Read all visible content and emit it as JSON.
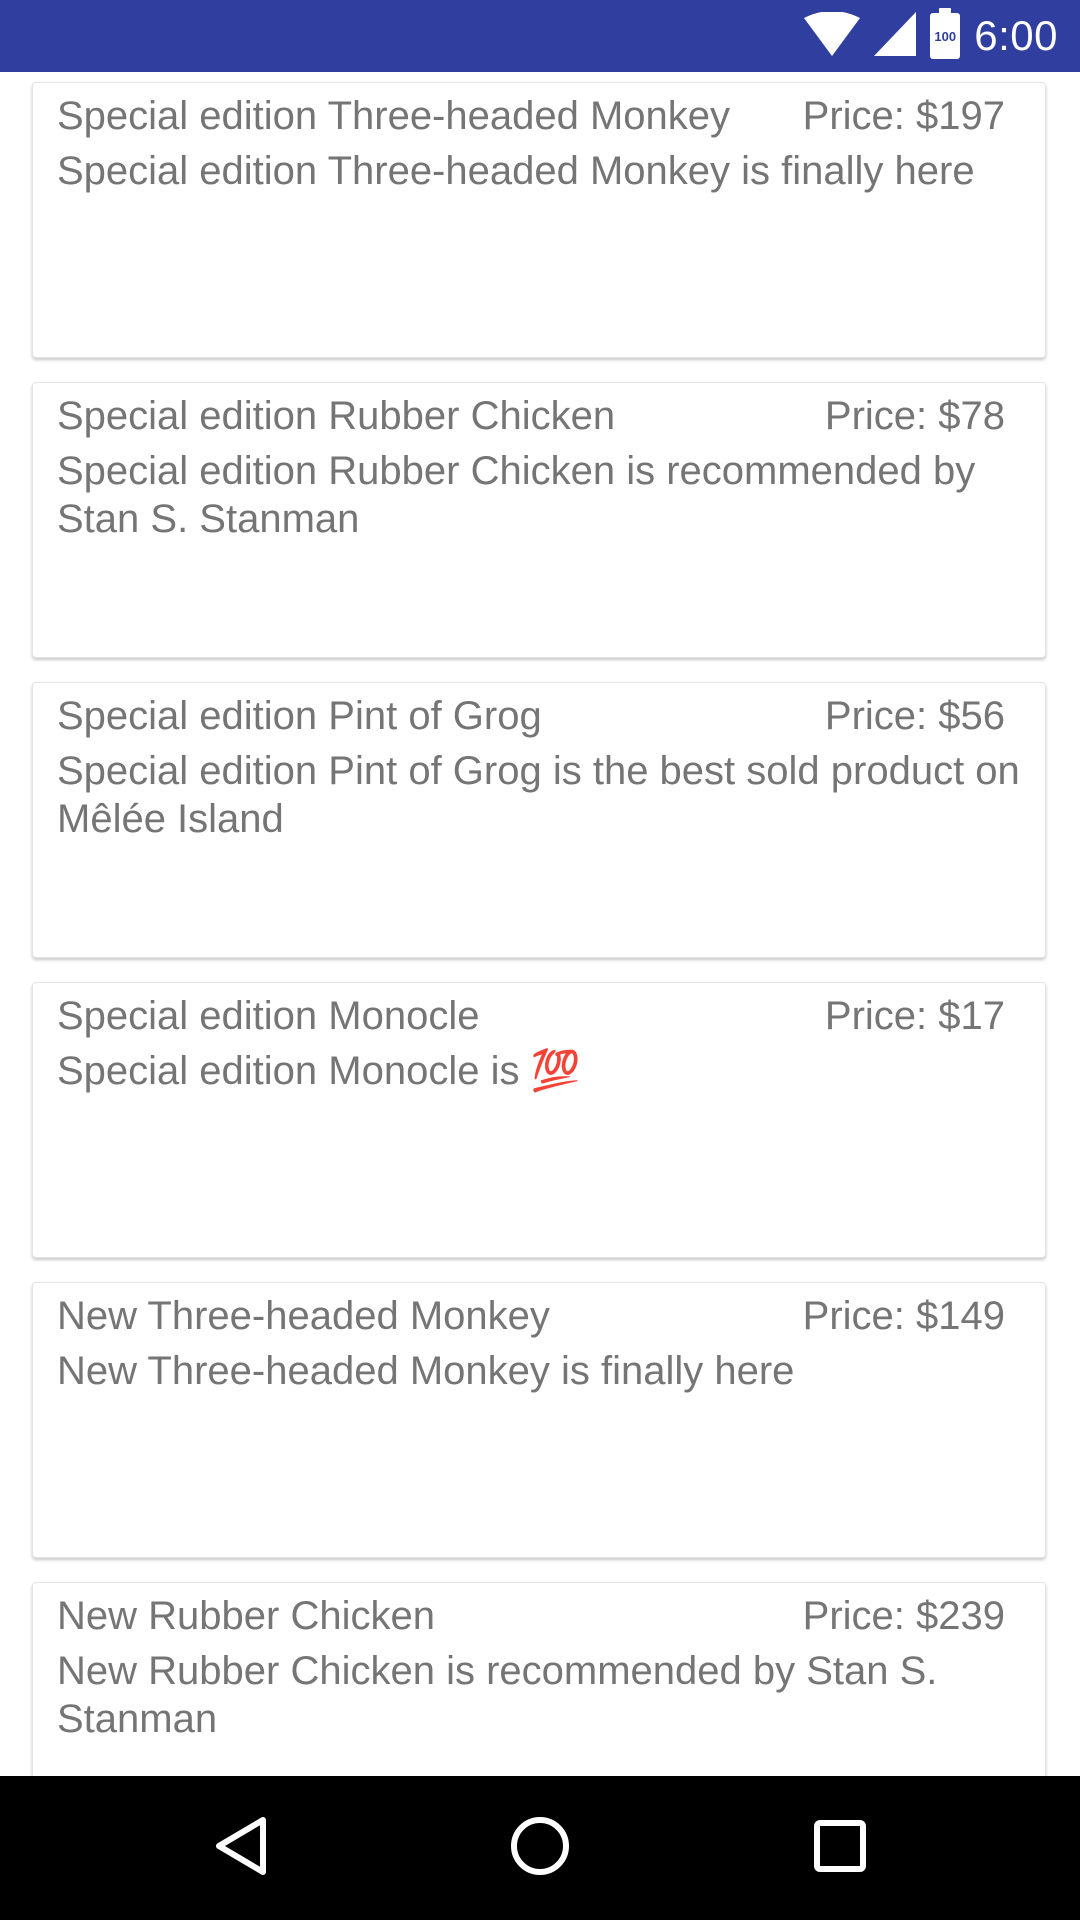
{
  "status_bar": {
    "time": "6:00",
    "battery_level": "100",
    "bar_color": "#303f9f",
    "icons": [
      "wifi-icon",
      "cellular-signal-icon",
      "battery-icon"
    ]
  },
  "products": [
    {
      "title": "Special edition Three-headed Monkey",
      "price": "Price: $197",
      "description": "Special edition Three-headed Monkey is finally here"
    },
    {
      "title": "Special edition Rubber Chicken",
      "price": "Price: $78",
      "description": "Special edition Rubber Chicken is recommended by Stan S. Stanman"
    },
    {
      "title": "Special edition Pint of Grog",
      "price": "Price: $56",
      "description": "Special edition Pint of Grog is the best sold product on Mêlée Island"
    },
    {
      "title": "Special edition Monocle",
      "price": "Price: $17",
      "description": "Special edition Monocle is 💯"
    },
    {
      "title": "New Three-headed Monkey",
      "price": "Price: $149",
      "description": "New Three-headed Monkey is finally here"
    },
    {
      "title": "New Rubber Chicken",
      "price": "Price: $239",
      "description": "New Rubber Chicken is recommended by Stan S. Stanman"
    }
  ],
  "nav_bar": {
    "icons": [
      "back-icon",
      "home-icon",
      "recents-icon"
    ]
  }
}
